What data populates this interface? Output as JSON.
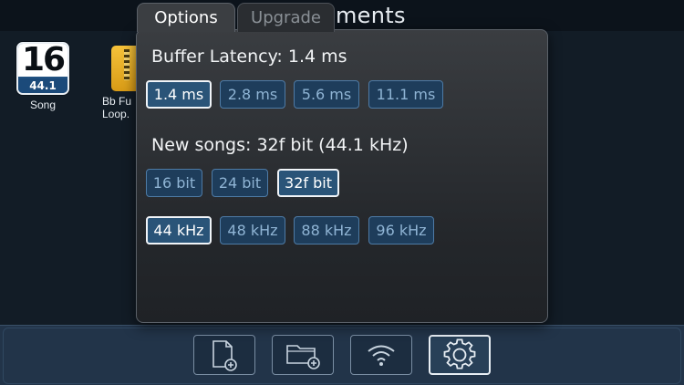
{
  "window": {
    "title_partial": "ments"
  },
  "desktop": {
    "files": [
      {
        "name": "Song",
        "badge_top": "16",
        "badge_bottom": "44.1 kHz"
      },
      {
        "name_line1": "Bb Fu",
        "name_line2": "Loop."
      }
    ]
  },
  "popover": {
    "tabs": [
      {
        "label": "Options",
        "active": true
      },
      {
        "label": "Upgrade",
        "active": false
      }
    ],
    "buffer": {
      "label": "Buffer Latency: 1.4 ms",
      "options": [
        "1.4 ms",
        "2.8 ms",
        "5.6 ms",
        "11.1 ms"
      ],
      "selected": "1.4 ms"
    },
    "new_songs": {
      "label": "New songs: 32f bit (44.1 kHz)",
      "bit_options": [
        "16 bit",
        "24 bit",
        "32f bit"
      ],
      "bit_selected": "32f bit",
      "rate_options": [
        "44 kHz",
        "48 kHz",
        "88 kHz",
        "96 kHz"
      ],
      "rate_selected": "44 kHz"
    }
  },
  "dock": {
    "buttons": [
      {
        "icon": "new-file-icon"
      },
      {
        "icon": "new-folder-icon"
      },
      {
        "icon": "wifi-icon"
      },
      {
        "icon": "gear-icon",
        "active": true
      }
    ]
  },
  "colors": {
    "accent": "#2a5478",
    "option_bg": "#1e3d5b",
    "option_text": "#8fb4d4",
    "dock_bg": "#223449"
  }
}
